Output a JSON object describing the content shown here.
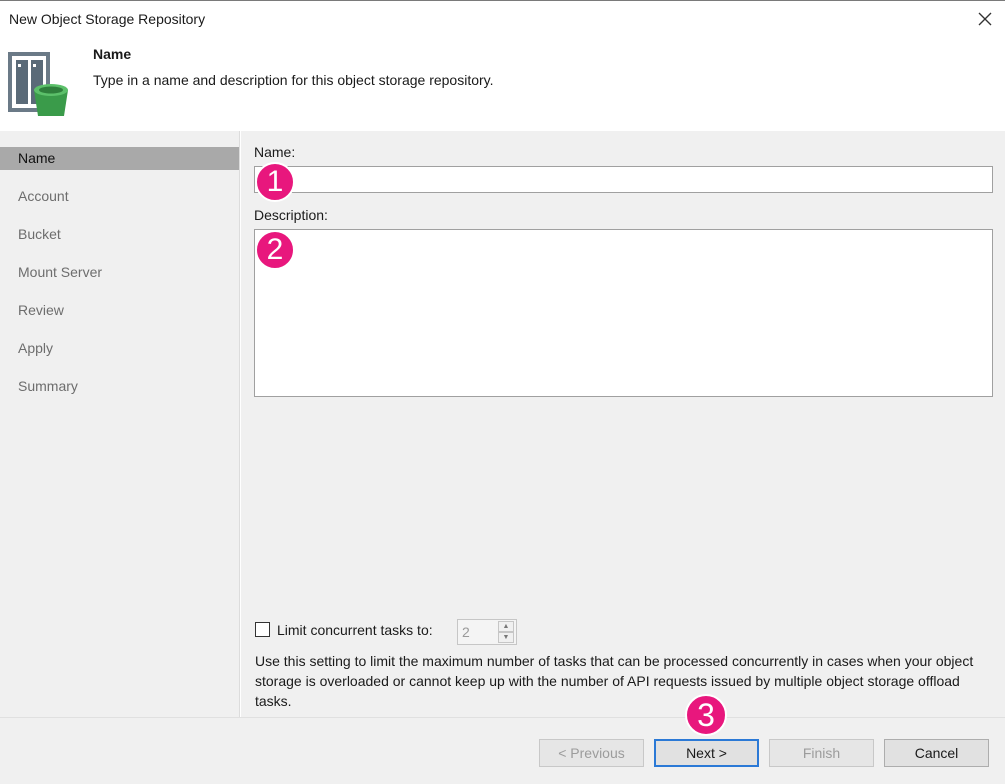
{
  "window": {
    "title": "New Object Storage Repository"
  },
  "header": {
    "title": "Name",
    "description": "Type in a name and description for this object storage repository."
  },
  "sidebar": {
    "items": [
      {
        "label": "Name",
        "active": true
      },
      {
        "label": "Account"
      },
      {
        "label": "Bucket"
      },
      {
        "label": "Mount Server"
      },
      {
        "label": "Review"
      },
      {
        "label": "Apply"
      },
      {
        "label": "Summary"
      }
    ]
  },
  "form": {
    "name_label": "Name:",
    "name_value": "",
    "description_label": "Description:",
    "description_value": "",
    "limit_label": "Limit concurrent tasks to:",
    "limit_checked": false,
    "limit_value": "2",
    "hint": "Use this setting to limit the maximum number of tasks that can be processed concurrently in cases when your object storage is overloaded or cannot keep up with the number of API requests issued by multiple object storage offload tasks."
  },
  "annotations": {
    "one": "1",
    "two": "2",
    "three": "3"
  },
  "footer": {
    "previous": "< Previous",
    "next": "Next >",
    "finish": "Finish",
    "cancel": "Cancel"
  },
  "icons": {
    "close": "close-icon",
    "logo": "object-storage-repository-icon"
  },
  "colors": {
    "accent": "#2b79d6",
    "badge": "#e8177d",
    "active_nav": "#a9a9a9",
    "panel_bg": "#f0f0f0"
  }
}
